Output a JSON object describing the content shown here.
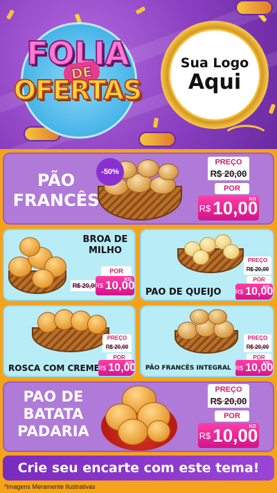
{
  "header": {
    "title_line1": "FOLIA",
    "title_line2": "DE",
    "title_line3": "OFERTAS",
    "logo_line1": "Sua Logo",
    "logo_line2": "Aqui"
  },
  "products": [
    {
      "name": "PÃO FRANCÊS",
      "discount": "-50%",
      "price_label": "PREÇO",
      "old_price": "R$ 20,00",
      "por_label": "POR",
      "currency": "R$",
      "price": "10,00",
      "unit": "KG"
    },
    {
      "name": "BROA DE MILHO",
      "por_label": "POR",
      "old_price": "R$ 20,00",
      "currency": "R$",
      "price": "10,00",
      "unit": "KG"
    },
    {
      "name": "PAO DE QUEIJO",
      "price_label": "PREÇO",
      "old_price": "R$ 20,00",
      "por_label": "POR",
      "currency": "R$",
      "price": "10,00",
      "unit": "KG"
    },
    {
      "name": "ROSCA COM CREME",
      "price_label": "PREÇO",
      "old_price": "R$ 20,00",
      "por_label": "POR",
      "currency": "R$",
      "price": "10,00",
      "unit": "KG"
    },
    {
      "name": "PÃO FRANCÊS INTEGRAL",
      "price_label": "PREÇO",
      "old_price": "R$ 20,00",
      "por_label": "POR",
      "currency": "R$",
      "price": "10,00",
      "unit": "KG"
    },
    {
      "name": "PAO DE BATATA PADARIA",
      "price_label": "PREÇO",
      "old_price": "R$ 20,00",
      "por_label": "POR",
      "currency": "R$",
      "price": "10,00",
      "unit": "KG"
    }
  ],
  "footer": {
    "cta": "Crie seu encarte com este tema!",
    "disclaimer": "*Imagens Meramente Ilustrativas"
  },
  "colors": {
    "header_purple": "#8a3fc0",
    "background_orange": "#f6a21a",
    "price_pink": "#d3128a",
    "card_purple": "#b07ad8",
    "card_cyan": "#b8ecf7"
  }
}
